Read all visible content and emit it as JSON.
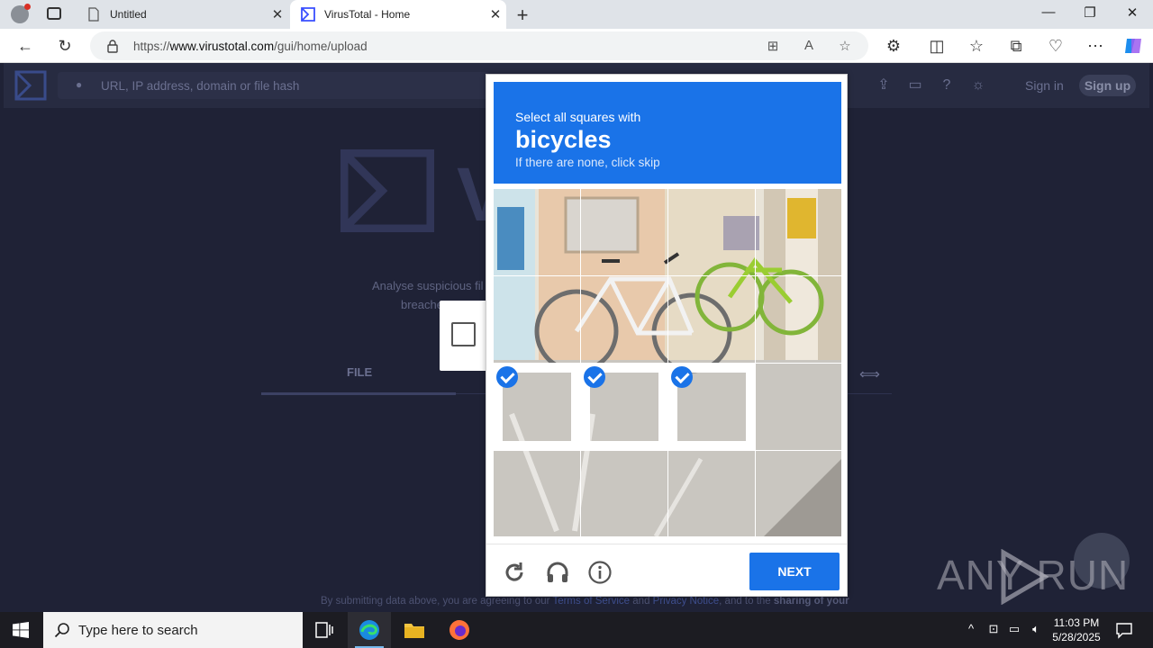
{
  "browser": {
    "tabs": [
      {
        "label": "Untitled",
        "active": false
      },
      {
        "label": "VirusTotal - Home",
        "active": true
      }
    ],
    "url_prefix": "https://",
    "url_host": "www.virustotal.com",
    "url_path": "/gui/home/upload"
  },
  "virustotal": {
    "search_placeholder": "URL, IP address, domain or file hash",
    "sign_in": "Sign in",
    "sign_up": "Sign up",
    "logo_text": "V",
    "tagline_line1": "Analyse suspicious fil",
    "tagline_line2": "breache",
    "tab_file": "FILE",
    "terms": {
      "prefix": "By submitting data above, you are agreeing to our ",
      "tos": "Terms of Service",
      "and": " and ",
      "privacy": "Privacy Notice",
      "suffix": ", and to the ",
      "bold": "sharing of your"
    }
  },
  "captcha": {
    "instruction": "Select all squares with",
    "target": "bicycles",
    "hint": "If there are none, click skip",
    "next_label": "NEXT",
    "selected_tiles": [
      8,
      9,
      10
    ],
    "accent": "#1a73e8"
  },
  "watermark": "ANY RUN",
  "taskbar": {
    "search_placeholder": "Type here to search",
    "time": "11:03 PM",
    "date": "5/28/2025"
  }
}
